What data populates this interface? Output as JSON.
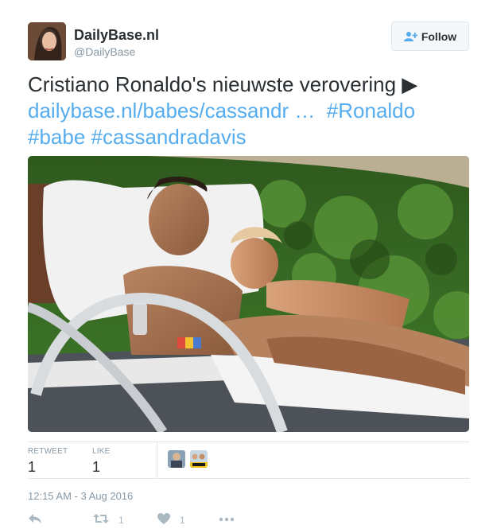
{
  "account": {
    "name": "DailyBase.nl",
    "handle": "@DailyBase",
    "follow_label": "Follow"
  },
  "tweet": {
    "text_plain": "Cristiano Ronaldo's nieuwste verovering ▶",
    "link": "dailybase.nl/babes/cassandr …",
    "hashtags": [
      "#Ronaldo",
      "#babe",
      "#cassandradavis"
    ]
  },
  "stats": {
    "retweet_label": "RETWEET",
    "retweet_count": "1",
    "like_label": "LIKE",
    "like_count": "1"
  },
  "timestamp": "12:15 AM - 3 Aug 2016",
  "actions": {
    "reply_icon": "reply-icon",
    "retweet_count": "1",
    "like_count": "1",
    "more_icon": "more-icon"
  },
  "colors": {
    "accent": "#55acee",
    "text": "#292f33",
    "muted": "#8899a6",
    "border": "#e1e8ed"
  }
}
